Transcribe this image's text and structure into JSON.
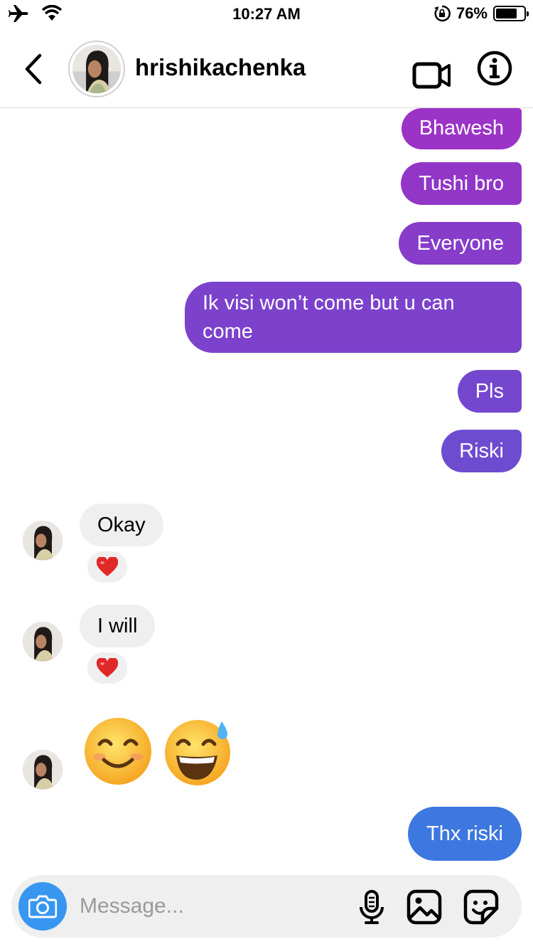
{
  "status_bar": {
    "time": "10:27 AM",
    "battery_text": "76%",
    "battery_level": 0.76,
    "icons": [
      "airplane-icon",
      "wifi-icon",
      "orientation-lock-icon",
      "battery-icon"
    ]
  },
  "header": {
    "username": "hrishikachenka",
    "icons": [
      "back-chevron-icon",
      "video-camera-icon",
      "info-icon"
    ]
  },
  "messages": {
    "sent": [
      {
        "text": "Bhawesh"
      },
      {
        "text": "Tushi bro"
      },
      {
        "text": "Everyone"
      },
      {
        "text_line1": "Ik visi won’t come but u can",
        "text_line2": "come"
      },
      {
        "text": "Pls"
      },
      {
        "text": "Riski"
      }
    ],
    "received": [
      {
        "text": "Okay",
        "reaction": "❤️"
      },
      {
        "text": "I will",
        "reaction": "❤️"
      },
      {
        "emojis": [
          "😊",
          "😅"
        ]
      }
    ],
    "last_sent": {
      "text": "Thx riski"
    }
  },
  "colors": {
    "sent_gradient_top": "#9B33C6",
    "sent_gradient_bottom": "#6E4CD0",
    "last_sent": "#3D78E0",
    "received_bg": "#EFEFEF",
    "camera_button": "#3797F0",
    "heart": "#E02828"
  },
  "composer": {
    "placeholder": "Message...",
    "icons": [
      "camera-icon",
      "microphone-icon",
      "gallery-icon",
      "sticker-icon"
    ]
  }
}
